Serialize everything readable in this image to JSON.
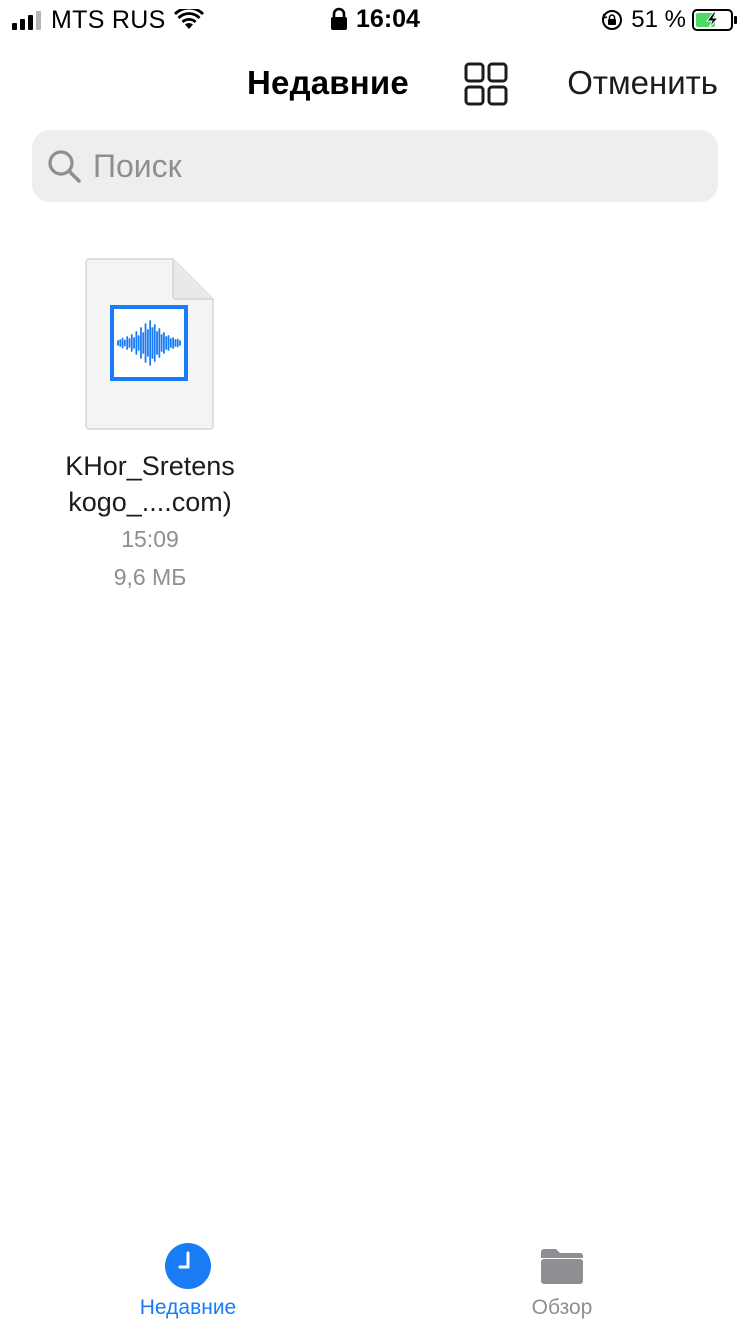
{
  "status_bar": {
    "carrier": "MTS RUS",
    "time": "16:04",
    "battery_percent": "51 %",
    "signal_bars_filled": 3,
    "signal_bars_total": 4,
    "icons": [
      "signal-icon",
      "wifi-icon",
      "lock-icon",
      "orientation-lock-icon",
      "battery-charging-icon"
    ]
  },
  "nav": {
    "title": "Недавние",
    "grid_icon": "grid-view-icon",
    "cancel_label": "Отменить"
  },
  "search": {
    "placeholder": "Поиск",
    "value": ""
  },
  "files": [
    {
      "name_line1": "KHor_Sretens",
      "name_line2": "kogo_....com)",
      "time": "15:09",
      "size": "9,6 МБ",
      "icon": "audio-file-icon"
    }
  ],
  "tab_bar": {
    "tabs": [
      {
        "label": "Недавние",
        "icon": "clock-icon",
        "active": true
      },
      {
        "label": "Обзор",
        "icon": "folder-icon",
        "active": false
      }
    ]
  },
  "colors": {
    "accent": "#1a7cf5",
    "waveform": "#1a7cf5",
    "inactive": "#8e8e93",
    "search_bg": "#eeeeef",
    "battery_fill": "#4cd964"
  }
}
